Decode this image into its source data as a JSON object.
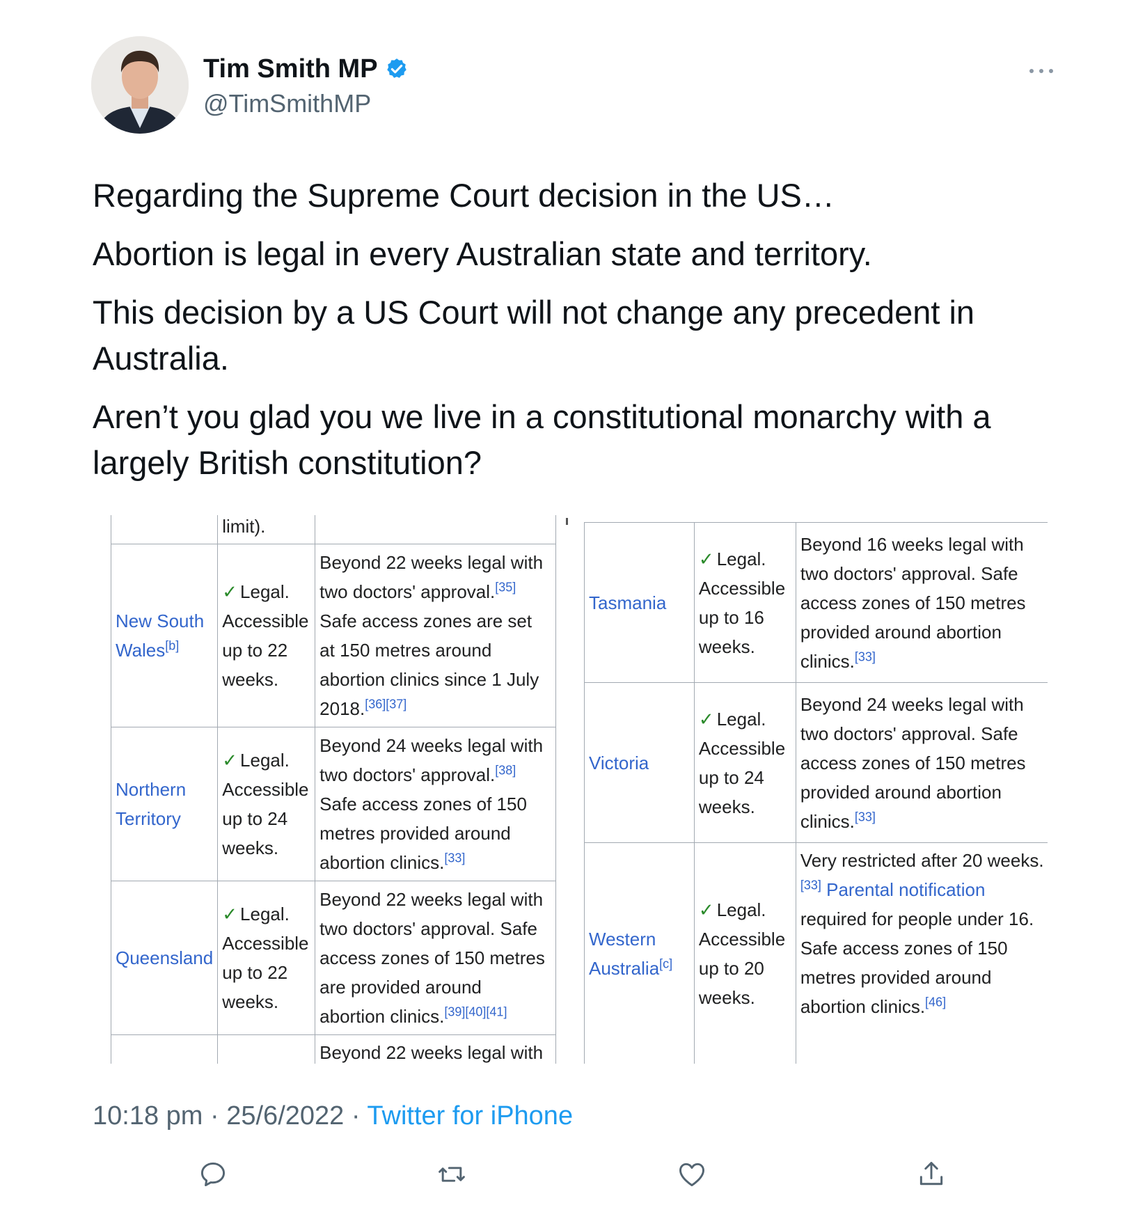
{
  "author": {
    "name": "Tim Smith MP",
    "handle": "@TimSmithMP",
    "verified": true
  },
  "tweet": {
    "paragraphs": [
      "Regarding the Supreme Court decision in the US…",
      "Abortion is legal in every Australian state and territory.",
      "This decision by a US Court will not change any precedent in Australia.",
      "Aren’t you glad you we live in a  constitutional monarchy with a largely British constitution?"
    ],
    "time": "10:18 pm",
    "date": "25/6/2022",
    "separator": "·",
    "source": "Twitter for iPhone"
  },
  "media": {
    "left_table": {
      "top_fragment": "limit).",
      "rows": [
        {
          "region": "New South Wales",
          "region_note": "[b]",
          "status": "Legal. Accessible up to 22 weeks.",
          "details": "Beyond 22 weeks legal with two doctors' approval.",
          "ref1": "[35]",
          "details2": "Safe access zones are set at 150 metres around abortion clinics since 1 July 2018.",
          "ref2": "[36][37]"
        },
        {
          "region": "Northern Territory",
          "status": "Legal. Accessible up to 24 weeks.",
          "details": "Beyond 24 weeks legal with two doctors' approval.",
          "ref1": "[38]",
          "details2": "Safe access zones of 150 metres provided around abortion clinics.",
          "ref2": "[33]"
        },
        {
          "region": "Queensland",
          "status": "Legal. Accessible up to 22 weeks.",
          "details": "Beyond 22 weeks legal with two doctors' approval. Safe access zones of 150 metres are provided around abortion clinics.",
          "ref1": "[39][40][41]"
        }
      ],
      "bottom_fragment": "Beyond 22 weeks legal with"
    },
    "right_table": {
      "rows": [
        {
          "region": "Tasmania",
          "status": "Legal. Accessible up to 16 weeks.",
          "details": "Beyond 16 weeks legal with two doctors' approval. Safe access zones of 150 metres provided around abortion clinics.",
          "ref1": "[33]"
        },
        {
          "region": "Victoria",
          "status": "Legal. Accessible up to 24 weeks.",
          "details": "Beyond 24 weeks legal with two doctors' approval. Safe access zones of 150 metres provided around abortion clinics.",
          "ref1": "[33]"
        },
        {
          "region": "Western Australia",
          "region_note": "[c]",
          "status": "Legal. Accessible up to 20 weeks.",
          "details_pre": "Very restricted after 20 weeks.",
          "ref_pre": "[33]",
          "link": "Parental notification",
          "details": "required for people under 16. Safe access zones of 150 metres provided around abortion clinics.",
          "ref1": "[46]"
        }
      ]
    }
  },
  "icons": {
    "more": "more-horizontal-icon",
    "verified": "verified-badge-icon",
    "reply": "reply-icon",
    "retweet": "retweet-icon",
    "like": "like-icon",
    "share": "share-icon"
  },
  "colors": {
    "verified": "#1d9bf0",
    "link": "#1d9bf0",
    "wiki_link": "#3366cc",
    "muted": "#536471",
    "check": "#2a8a2a"
  }
}
